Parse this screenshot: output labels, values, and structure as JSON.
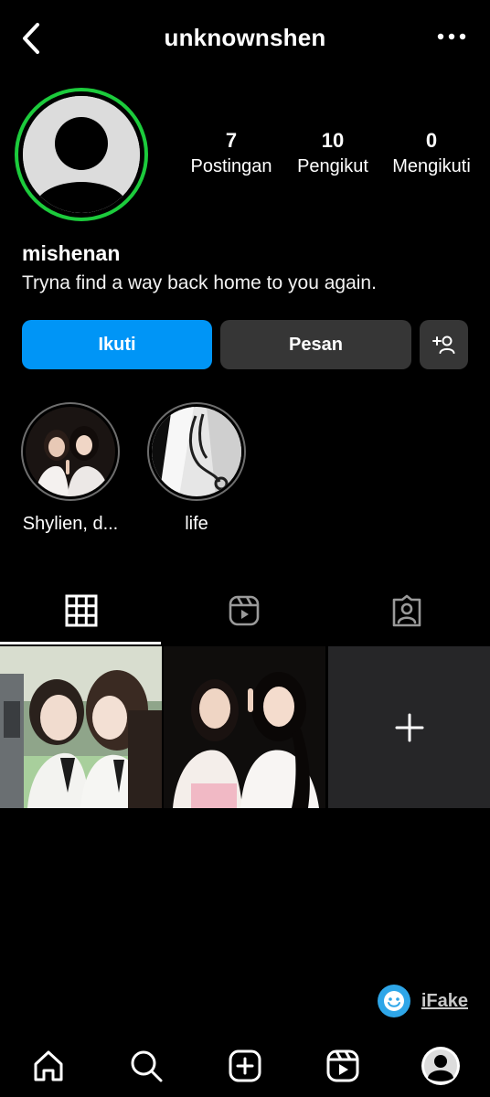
{
  "header": {
    "username": "unknownshen"
  },
  "profile": {
    "display_name": "mishenan",
    "bio": "Tryna find a way back home to you again.",
    "stats": [
      {
        "value": "7",
        "label": "Postingan"
      },
      {
        "value": "10",
        "label": "Pengikut"
      },
      {
        "value": "0",
        "label": "Mengikuti"
      }
    ]
  },
  "actions": {
    "follow_label": "Ikuti",
    "message_label": "Pesan"
  },
  "highlights": [
    {
      "label": "Shylien, d..."
    },
    {
      "label": "life"
    }
  ],
  "tabs": [
    {
      "icon": "grid-icon",
      "active": true
    },
    {
      "icon": "reels-icon",
      "active": false
    },
    {
      "icon": "tagged-icon",
      "active": false
    }
  ],
  "watermark": {
    "text": "iFake"
  },
  "colors": {
    "background": "#000000",
    "follow_button": "#0095f6",
    "secondary_button": "#363636",
    "story_ring": "#1ccb3c"
  }
}
